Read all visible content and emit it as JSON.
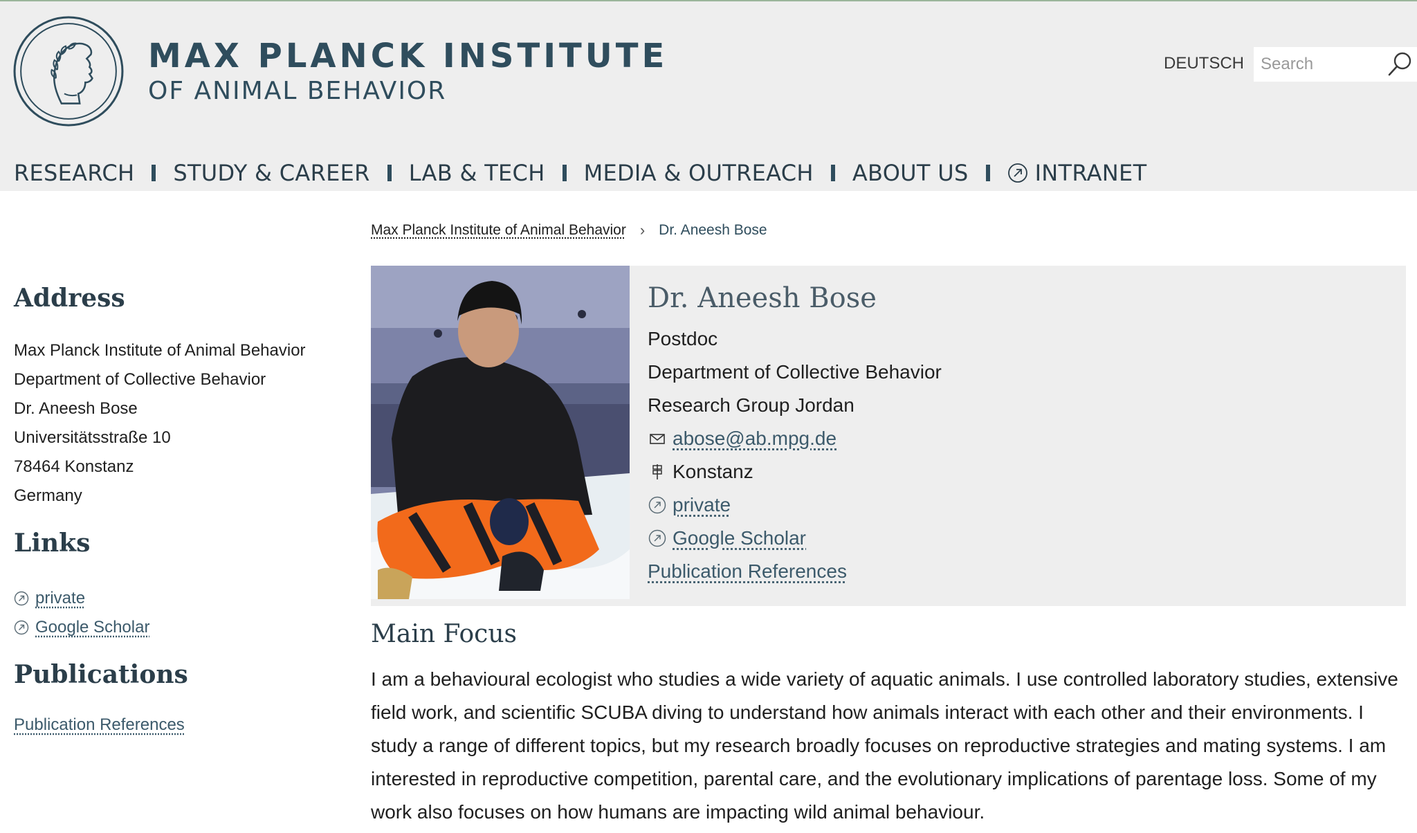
{
  "header": {
    "logo_line1": "MAX PLANCK INSTITUTE",
    "logo_line2": "OF ANIMAL BEHAVIOR",
    "language_link": "DEUTSCH",
    "search_placeholder": "Search",
    "search_icon": "magnifier-icon",
    "seal_icon": "minerva-seal-icon"
  },
  "nav": {
    "items": [
      {
        "label": "RESEARCH"
      },
      {
        "label": "STUDY & CAREER"
      },
      {
        "label": "LAB & TECH"
      },
      {
        "label": "MEDIA & OUTREACH"
      },
      {
        "label": "ABOUT US"
      },
      {
        "label": "INTRANET",
        "icon": "external-link-icon"
      }
    ]
  },
  "breadcrumb": {
    "parent": "Max Planck Institute of Animal Behavior",
    "separator": "›",
    "current": "Dr. Aneesh Bose"
  },
  "sidebar": {
    "address_heading": "Address",
    "address_lines": [
      "Max Planck Institute of Animal Behavior",
      "Department of Collective Behavior",
      "Dr. Aneesh Bose",
      "Universitätsstraße 10",
      "78464 Konstanz",
      "Germany"
    ],
    "links_heading": "Links",
    "links": [
      {
        "label": "private",
        "icon": "external-link-icon"
      },
      {
        "label": "Google Scholar",
        "icon": "external-link-icon"
      }
    ],
    "publications_heading": "Publications",
    "publications_link": "Publication References"
  },
  "profile": {
    "name": "Dr. Aneesh Bose",
    "position": "Postdoc",
    "department": "Department of Collective Behavior",
    "group": "Research Group Jordan",
    "email": "abose@ab.mpg.de",
    "location": "Konstanz",
    "links": [
      {
        "label": "private",
        "icon": "external-link-icon"
      },
      {
        "label": "Google Scholar",
        "icon": "external-link-icon"
      }
    ],
    "publications_link": "Publication References"
  },
  "main_focus": {
    "heading": "Main Focus",
    "text": "I am a behavioural ecologist who studies a wide variety of aquatic animals. I use controlled laboratory studies, extensive field work, and scientific SCUBA diving to understand how animals interact with each other and their environments. I study a range of different topics, but my research broadly focuses on reproductive strategies and mating systems. I am interested in reproductive competition, parental care, and the evolutionary implications of parentage loss. Some of my work also focuses on how humans are impacting wild animal behaviour."
  },
  "colors": {
    "brand": "#2f4d5d",
    "header_bg": "#eeeeee",
    "link": "#3c5a6b"
  }
}
